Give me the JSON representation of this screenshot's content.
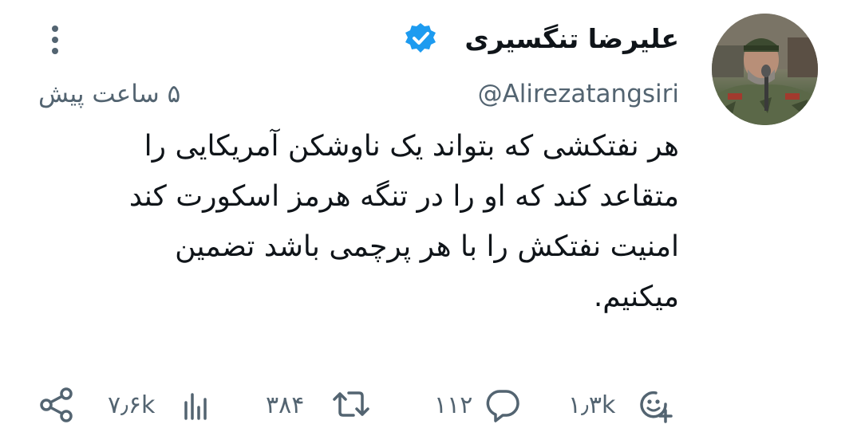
{
  "tweet": {
    "author": {
      "display_name": "علیرضا تنگسیری",
      "handle": "@Alirezatangsiri",
      "verified": true,
      "verified_color": "#1d9bf0",
      "avatar_icon": "profile-photo"
    },
    "timestamp": "۵ ساعت پیش",
    "text_lines": [
      "هر نفتکشی که بتواند یک ناوشکن آمریکایی را",
      "متقاعد کند که او را در تنگه هرمز اسکورت کند",
      "امنیت نفتکش  را با هر پرچمی باشد تضمین",
      "میکنیم."
    ],
    "actions": {
      "reactions": {
        "icon": "add-reaction-icon",
        "count": "۱٫۳k"
      },
      "replies": {
        "icon": "reply-icon",
        "count": "۱۱۲"
      },
      "retweets": {
        "icon": "retweet-icon",
        "count": "۳۸۴"
      },
      "views": {
        "icon": "views-icon",
        "count": "۷٫۶k"
      },
      "share": {
        "icon": "share-icon"
      }
    },
    "more_icon": "more-options-icon"
  },
  "colors": {
    "text": "#0f1419",
    "muted": "#536471",
    "background": "#ffffff"
  }
}
